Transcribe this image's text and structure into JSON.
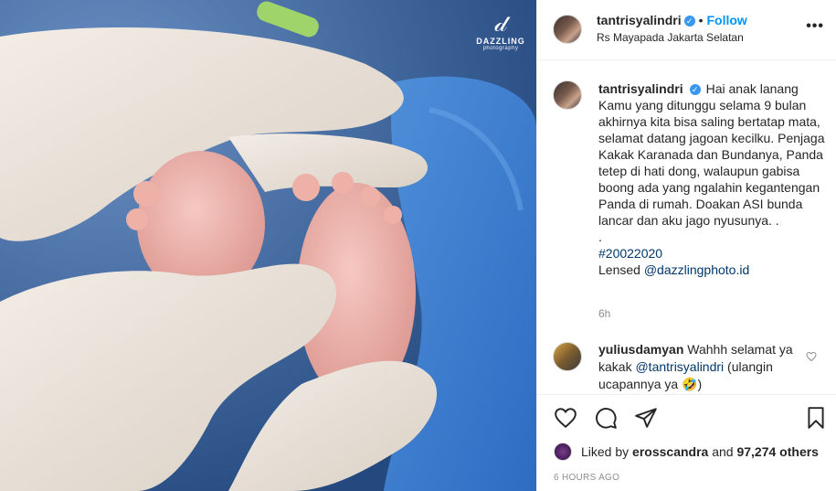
{
  "post": {
    "author": "tantrisyalindri",
    "follow_label": "Follow",
    "location": "Rs Mayapada Jakarta Selatan",
    "separator": "•",
    "more_label": "•••"
  },
  "watermark": {
    "brand": "DAZZLING",
    "sub": "photography"
  },
  "caption": {
    "author": "tantrisyalindri",
    "body": "Hai anak lanang Kamu yang ditunggu selama 9 bulan akhirnya kita bisa saling bertatap mata, selamat datang jagoan kecilku. Penjaga Kakak Karanada dan Bundanya, Panda tetep di hati dong, walaupun gabisa boong ada yang ngalahin kegantengan Panda di rumah. Doakan ASI bunda lancar dan aku jago nyusunya. .",
    "dot_line": ".",
    "hashtag": "#20022020",
    "lensed_label": "Lensed",
    "lensed_mention": "@dazzlingphoto.id",
    "time_ago": "6h"
  },
  "comment": {
    "author": "yuliusdamyan",
    "text_1": "Wahhh selamat ya kakak",
    "mention": "@tantrisyalindri",
    "text_2": "(ulangin ucapannya ya 🤣)"
  },
  "likes": {
    "prefix": "Liked by",
    "user": "erosscandra",
    "conjunction": "and",
    "count": "97,274 others"
  },
  "timestamp": "6 HOURS AGO",
  "icons": [
    "heart-icon",
    "comment-icon",
    "share-icon",
    "bookmark-icon",
    "more-icon",
    "verified-icon"
  ],
  "colors": {
    "follow": "#0095f6",
    "verified": "#3897f0",
    "link": "#00376b",
    "muted": "#8e8e8e"
  }
}
